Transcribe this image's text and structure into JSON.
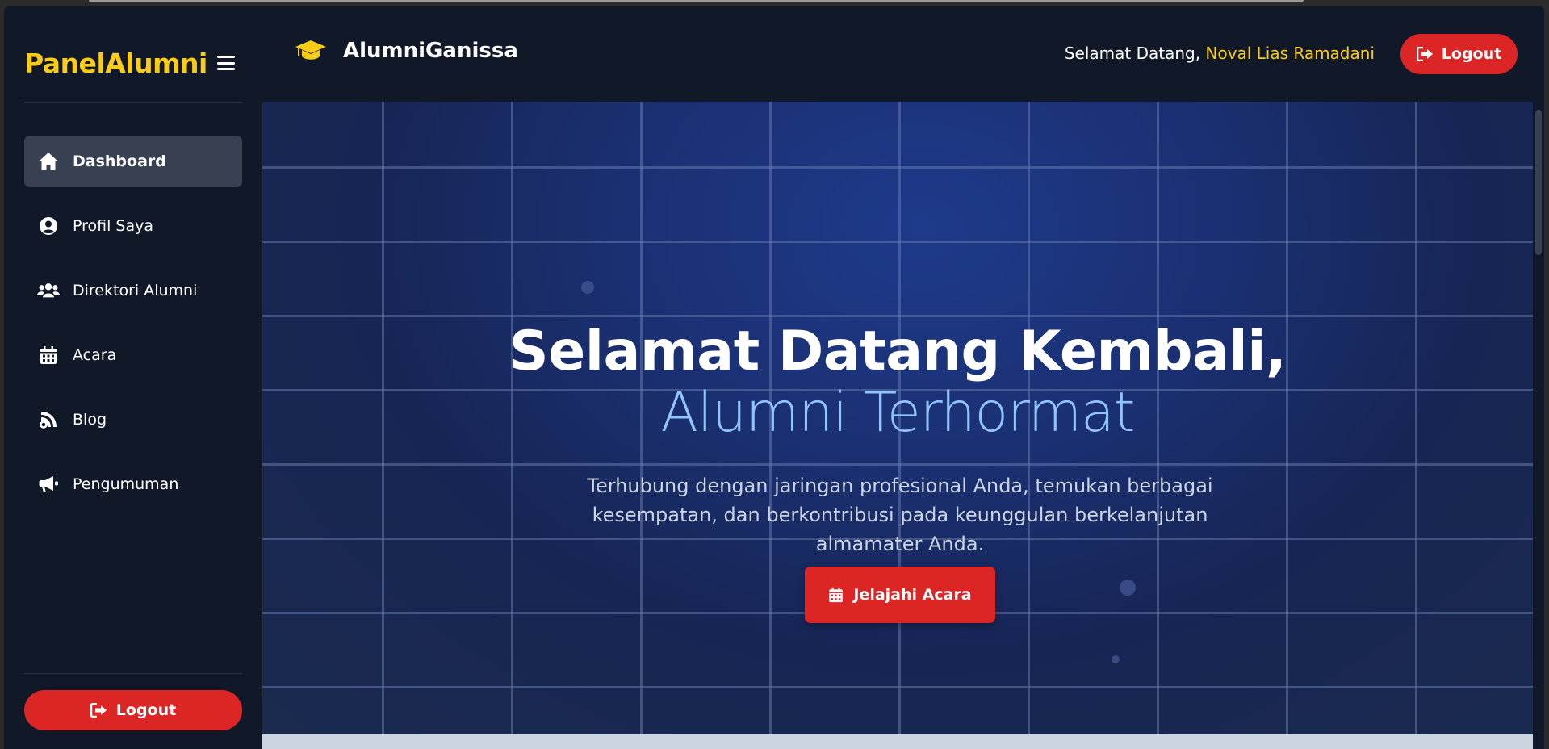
{
  "sidebar": {
    "brand": "PanelAlumni",
    "items": [
      {
        "label": "Dashboard",
        "icon": "home-icon",
        "active": true
      },
      {
        "label": "Profil Saya",
        "icon": "user-circle-icon"
      },
      {
        "label": "Direktori Alumni",
        "icon": "users-icon"
      },
      {
        "label": "Acara",
        "icon": "calendar-icon"
      },
      {
        "label": "Blog",
        "icon": "blog-icon"
      },
      {
        "label": "Pengumuman",
        "icon": "megaphone-icon"
      }
    ],
    "logout_label": "Logout"
  },
  "header": {
    "app_title": "AlumniGanissa",
    "welcome_prefix": "Selamat Datang,",
    "user_name": "Noval Lias Ramadani",
    "logout_label": "Logout"
  },
  "hero": {
    "title": "Selamat Datang Kembali,",
    "subtitle": "Alumni Terhormat",
    "description": "Terhubung dengan jaringan profesional Anda, temukan berbagai kesempatan, dan berkontribusi pada keunggulan berkelanjutan almamater Anda.",
    "button_label": "Jelajahi Acara"
  },
  "colors": {
    "accent_yellow": "#facc15",
    "accent_red": "#dc2626",
    "sidebar_bg": "#111827",
    "hero_blue": "#1e3a8a"
  }
}
